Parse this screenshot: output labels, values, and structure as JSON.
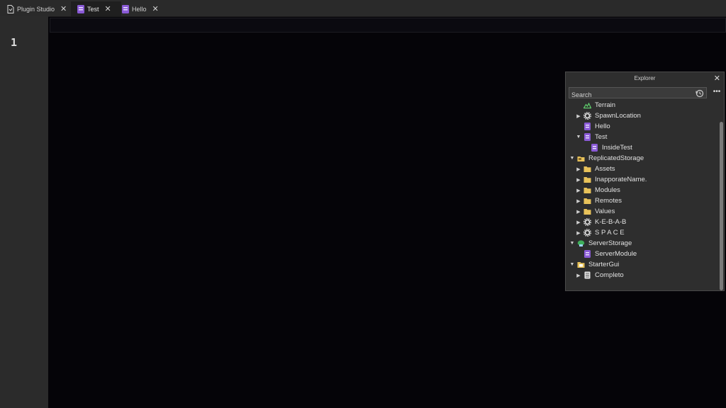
{
  "tabs": [
    {
      "label": "Plugin Studio",
      "close": "✕"
    },
    {
      "label": "Test",
      "close": "✕"
    },
    {
      "label": "Hello",
      "close": "✕"
    }
  ],
  "editor": {
    "line_number": "1"
  },
  "explorer": {
    "title": "Explorer",
    "close": "✕",
    "search_placeholder": "Search",
    "more": "•••",
    "items": [
      {
        "label": "Terrain",
        "icon": "terrain-icon",
        "expand": ""
      },
      {
        "label": "SpawnLocation",
        "icon": "spawn-gear-icon",
        "expand": "collapsed"
      },
      {
        "label": "Hello",
        "icon": "script-icon",
        "expand": ""
      },
      {
        "label": "Test",
        "icon": "script-icon",
        "expand": "expanded"
      },
      {
        "label": "InsideTest",
        "icon": "script-icon",
        "expand": ""
      },
      {
        "label": "ReplicatedStorage",
        "icon": "replicated-storage-icon",
        "expand": "expanded"
      },
      {
        "label": "Assets",
        "icon": "folder-icon",
        "expand": "collapsed"
      },
      {
        "label": "InapporateName.",
        "icon": "folder-icon",
        "expand": "collapsed"
      },
      {
        "label": "Modules",
        "icon": "folder-icon",
        "expand": "collapsed"
      },
      {
        "label": "Remotes",
        "icon": "folder-icon",
        "expand": "collapsed"
      },
      {
        "label": "Values",
        "icon": "folder-icon",
        "expand": "collapsed"
      },
      {
        "label": "K-E-B-A-B",
        "icon": "gear-icon",
        "expand": "collapsed"
      },
      {
        "label": "S P A C E",
        "icon": "gear-icon",
        "expand": "collapsed"
      },
      {
        "label": "ServerStorage",
        "icon": "server-storage-icon",
        "expand": "expanded"
      },
      {
        "label": "ServerModule",
        "icon": "script-icon",
        "expand": ""
      },
      {
        "label": "StarterGui",
        "icon": "starter-gui-icon",
        "expand": "expanded"
      },
      {
        "label": "Completo",
        "icon": "document-icon",
        "expand": "collapsed"
      }
    ]
  },
  "colors": {
    "script": "#8a5ad6",
    "folder": "#e8c25a",
    "terrain": "#5fcf6d",
    "server": "#3fae5a"
  }
}
